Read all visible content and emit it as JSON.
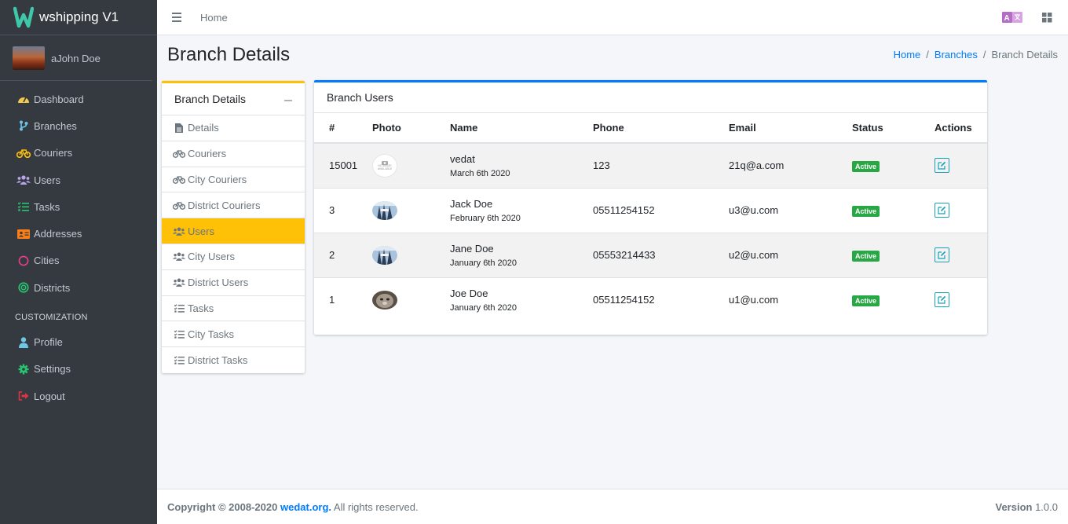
{
  "brand": {
    "title": "wshipping V1",
    "logo_letter": "W"
  },
  "user": {
    "name": "aJohn Doe"
  },
  "sidebar": {
    "items": [
      {
        "label": "Dashboard",
        "icon": "tachometer-icon",
        "color": "#f2c94c"
      },
      {
        "label": "Branches",
        "icon": "code-branch-icon",
        "color": "#6ec6e6"
      },
      {
        "label": "Couriers",
        "icon": "bicycle-icon",
        "color": "#ffc107"
      },
      {
        "label": "Users",
        "icon": "users-icon",
        "color": "#b9a6e8"
      },
      {
        "label": "Tasks",
        "icon": "tasks-icon",
        "color": "#28c76f"
      },
      {
        "label": "Addresses",
        "icon": "address-card-icon",
        "color": "#fd7e14"
      },
      {
        "label": "Cities",
        "icon": "circle-icon",
        "color": "#e83e8c"
      },
      {
        "label": "Districts",
        "icon": "bullseye-icon",
        "color": "#28c76f"
      }
    ],
    "section_header": "CUSTOMIZATION",
    "custom_items": [
      {
        "label": "Profile",
        "icon": "user-icon",
        "color": "#6ec6e6"
      },
      {
        "label": "Settings",
        "icon": "gear-icon",
        "color": "#28c76f"
      },
      {
        "label": "Logout",
        "icon": "sign-out-icon",
        "color": "#dc3545"
      }
    ]
  },
  "navbar": {
    "home": "Home"
  },
  "page": {
    "title": "Branch Details"
  },
  "breadcrumb": {
    "home": "Home",
    "branches": "Branches",
    "current": "Branch Details",
    "separator": "/"
  },
  "left_card": {
    "title": "Branch Details",
    "links": [
      {
        "label": "Details",
        "icon": "file-icon"
      },
      {
        "label": "Couriers",
        "icon": "bicycle-icon"
      },
      {
        "label": "City Couriers",
        "icon": "bicycle-icon"
      },
      {
        "label": "District Couriers",
        "icon": "bicycle-icon"
      },
      {
        "label": "Users",
        "icon": "users-icon",
        "active": true
      },
      {
        "label": "City Users",
        "icon": "users-icon"
      },
      {
        "label": "District Users",
        "icon": "users-icon"
      },
      {
        "label": "Tasks",
        "icon": "tasks-icon"
      },
      {
        "label": "City Tasks",
        "icon": "tasks-icon"
      },
      {
        "label": "District Tasks",
        "icon": "tasks-icon"
      }
    ]
  },
  "main_card": {
    "title": "Branch Users",
    "columns": [
      "#",
      "Photo",
      "Name",
      "Phone",
      "Email",
      "Status",
      "Actions"
    ],
    "rows": [
      {
        "id": "15001",
        "photo": "no-image",
        "name": "vedat",
        "date": "March 6th 2020",
        "phone": "123",
        "email": "21q@a.com",
        "status": "Active"
      },
      {
        "id": "3",
        "photo": "user-photo",
        "name": "Jack Doe",
        "date": "February 6th 2020",
        "phone": "05511254152",
        "email": "u3@u.com",
        "status": "Active"
      },
      {
        "id": "2",
        "photo": "user-photo",
        "name": "Jane Doe",
        "date": "January 6th 2020",
        "phone": "05553214433",
        "email": "u2@u.com",
        "status": "Active"
      },
      {
        "id": "1",
        "photo": "animal-photo",
        "name": "Joe Doe",
        "date": "January 6th 2020",
        "phone": "05511254152",
        "email": "u1@u.com",
        "status": "Active"
      }
    ],
    "no_image_text": "NO IMAGE AVAILABLE"
  },
  "footer": {
    "copyright": "Copyright © 2008-2020",
    "link": "wedat.org.",
    "rights": "All rights reserved.",
    "version_label": "Version",
    "version": "1.0.0"
  },
  "colors": {
    "accent": "#007bff",
    "warning": "#ffc107",
    "success": "#28a745",
    "sidebar": "#343a40"
  }
}
